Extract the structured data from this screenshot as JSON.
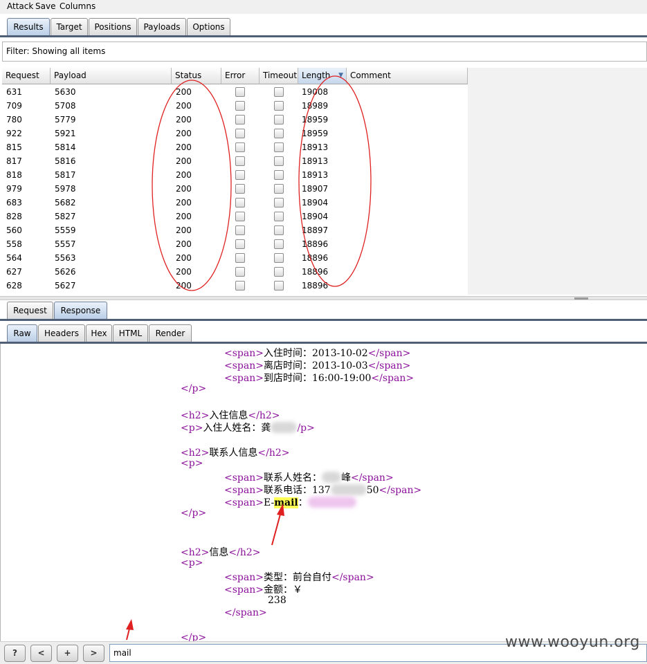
{
  "menu": [
    "Attack",
    "Save",
    "Columns"
  ],
  "main_tabs": [
    {
      "label": "Results",
      "active": true
    },
    {
      "label": "Target",
      "active": false
    },
    {
      "label": "Positions",
      "active": false
    },
    {
      "label": "Payloads",
      "active": false
    },
    {
      "label": "Options",
      "active": false
    }
  ],
  "filter": {
    "text": "Filter: Showing all items"
  },
  "table": {
    "columns": [
      "Request",
      "Payload",
      "Status",
      "Error",
      "Timeout",
      "Length",
      "Comment"
    ],
    "sorted_column": "Length",
    "rows": [
      {
        "request": "631",
        "payload": "5630",
        "status": "200",
        "length": "19008"
      },
      {
        "request": "709",
        "payload": "5708",
        "status": "200",
        "length": "18989"
      },
      {
        "request": "780",
        "payload": "5779",
        "status": "200",
        "length": "18959"
      },
      {
        "request": "922",
        "payload": "5921",
        "status": "200",
        "length": "18959"
      },
      {
        "request": "815",
        "payload": "5814",
        "status": "200",
        "length": "18913"
      },
      {
        "request": "817",
        "payload": "5816",
        "status": "200",
        "length": "18913"
      },
      {
        "request": "818",
        "payload": "5817",
        "status": "200",
        "length": "18913"
      },
      {
        "request": "979",
        "payload": "5978",
        "status": "200",
        "length": "18907"
      },
      {
        "request": "683",
        "payload": "5682",
        "status": "200",
        "length": "18904"
      },
      {
        "request": "828",
        "payload": "5827",
        "status": "200",
        "length": "18904"
      },
      {
        "request": "560",
        "payload": "5559",
        "status": "200",
        "length": "18897"
      },
      {
        "request": "558",
        "payload": "5557",
        "status": "200",
        "length": "18896"
      },
      {
        "request": "564",
        "payload": "5563",
        "status": "200",
        "length": "18896"
      },
      {
        "request": "627",
        "payload": "5626",
        "status": "200",
        "length": "18896"
      },
      {
        "request": "628",
        "payload": "5627",
        "status": "200",
        "length": "18896"
      }
    ]
  },
  "detail_tabs": [
    {
      "label": "Request",
      "active": false
    },
    {
      "label": "Response",
      "active": true
    }
  ],
  "view_tabs": [
    {
      "label": "Raw",
      "active": true
    },
    {
      "label": "Headers",
      "active": false
    },
    {
      "label": "Hex",
      "active": false
    },
    {
      "label": "HTML",
      "active": false
    },
    {
      "label": "Render",
      "active": false
    }
  ],
  "response": {
    "checkin_time": "入住时间：2013-10-02",
    "checkout_time": "离店时间：2013-10-03",
    "arrival_time": "到店时间：16:00-19:00",
    "h2_checkin_info": "入住信息",
    "guest_name_label": "入住人姓名：龚",
    "h2_contact_info": "联系人信息",
    "contact_name_label": "联系人姓名：",
    "contact_name_tail": "峰",
    "contact_phone_label": "联系电话：137",
    "contact_phone_tail": "50",
    "email_prefix": "E-",
    "email_highlight": "mail",
    "email_colon": "：",
    "h2_info": "信息",
    "type_text": "类型：前台自付",
    "amount_label": "金额：￥",
    "amount_value": "238"
  },
  "bottom": {
    "help": "?",
    "prev": "<",
    "add": "+",
    "next": ">",
    "search_value": "mail"
  },
  "watermark": "www.wooyun.org"
}
